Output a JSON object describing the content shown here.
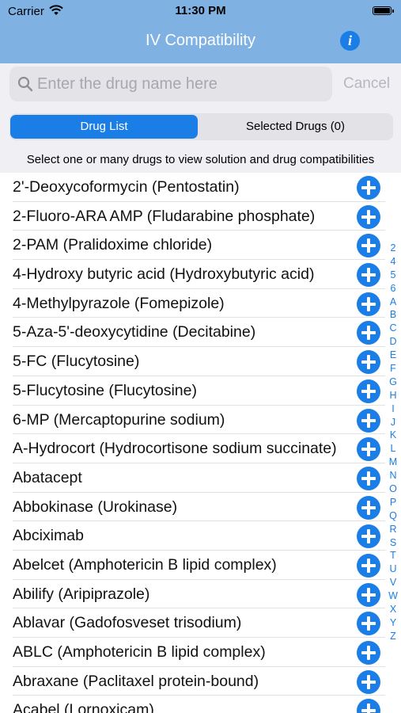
{
  "status_bar": {
    "carrier": "Carrier",
    "time": "11:30 PM"
  },
  "header": {
    "title": "IV Compatibility",
    "info_icon": "i"
  },
  "search": {
    "placeholder": "Enter the drug name here",
    "value": "",
    "cancel_label": "Cancel"
  },
  "tabs": [
    {
      "label": "Drug List",
      "active": true
    },
    {
      "label": "Selected Drugs (0)",
      "active": false
    }
  ],
  "instruction": "Select one or many drugs to view solution and drug compatibilities",
  "drugs": [
    "2'-Deoxycoformycin (Pentostatin)",
    "2-Fluoro-ARA AMP (Fludarabine phosphate)",
    "2-PAM (Pralidoxime chloride)",
    "4-Hydroxy butyric acid (Hydroxybutyric acid)",
    "4-Methylpyrazole (Fomepizole)",
    "5-Aza-5'-deoxycytidine (Decitabine)",
    "5-FC (Flucytosine)",
    "5-Flucytosine (Flucytosine)",
    "6-MP (Mercaptopurine sodium)",
    "A-Hydrocort (Hydrocortisone sodium succinate)",
    "Abatacept",
    "Abbokinase (Urokinase)",
    "Abciximab",
    "Abelcet (Amphotericin B lipid complex)",
    "Abilify (Aripiprazole)",
    "Ablavar (Gadofosveset trisodium)",
    "ABLC (Amphotericin B lipid complex)",
    "Abraxane (Paclitaxel protein-bound)",
    "Acabel (Lornoxicam)"
  ],
  "section_index": [
    "2",
    "4",
    "5",
    "6",
    "A",
    "B",
    "C",
    "D",
    "E",
    "F",
    "G",
    "H",
    "I",
    "J",
    "K",
    "L",
    "M",
    "N",
    "O",
    "P",
    "Q",
    "R",
    "S",
    "T",
    "U",
    "V",
    "W",
    "X",
    "Y",
    "Z"
  ],
  "colors": {
    "header": "#7fb2e3",
    "accent": "#1a7ee6",
    "background": "#efeff4"
  }
}
